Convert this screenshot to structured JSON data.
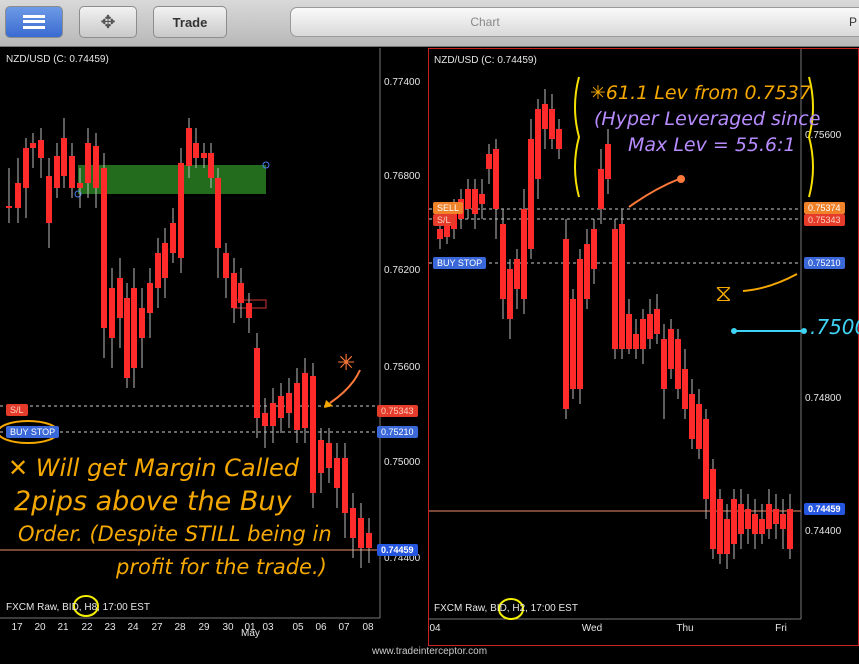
{
  "toolbar": {
    "trade_label": "Trade",
    "tab_chart": "Chart",
    "tab_partial": "P"
  },
  "left_chart": {
    "title": "NZD/USD (C: 0.74459)",
    "price_ticks": [
      "0.77400",
      "0.76800",
      "0.76200",
      "0.75600",
      "0.75000",
      "0.74400"
    ],
    "sl_value": "0.75343",
    "buy_stop_value": "0.75210",
    "current_value": "0.74459",
    "sl_label": "S/L",
    "buy_stop_label": "BUY STOP",
    "footer": "FXCM Raw, BID, H8, 17:00 EST",
    "x_ticks": [
      "17",
      "20",
      "21",
      "22",
      "23",
      "24",
      "27",
      "28",
      "29",
      "30",
      "01",
      "03",
      "05",
      "06",
      "07",
      "08"
    ],
    "x_month": "May"
  },
  "right_chart": {
    "title": "NZD/USD (C: 0.74459)",
    "price_ticks": [
      "0.75600",
      "0.74800",
      "0.74400"
    ],
    "sell_value": "0.75374",
    "sl_value": "0.75343",
    "buy_stop_value": "0.75210",
    "current_value": "0.74459",
    "sell_label": "SELL",
    "sl_label": "S/L",
    "buy_stop_label": "BUY STOP",
    "footer": "FXCM Raw, BID, H2, 17:00 EST",
    "x_ticks": [
      "04",
      "Wed",
      "Thu",
      "Fri"
    ]
  },
  "annotations": {
    "star_note_line1": "✳61.1 Lev from 0.7537",
    "star_note_line2": "(Hyper Leveraged since",
    "star_note_line3": "Max Lev = 55.6:1",
    "level_note": ".7500",
    "margin_line1": "✕ Will get Margin Called",
    "margin_line2": "2pips above the Buy",
    "margin_line3": "Order. (Despite STILL being in",
    "margin_line4": "profit for the trade.)"
  },
  "footer_url": "www.tradeinterceptor.com",
  "colors": {
    "bull": "#8fe63a",
    "bear": "#ff2a2a",
    "annotation": "#f5a800",
    "buy_stop": "#4a7df0",
    "sell": "#f0822a"
  }
}
